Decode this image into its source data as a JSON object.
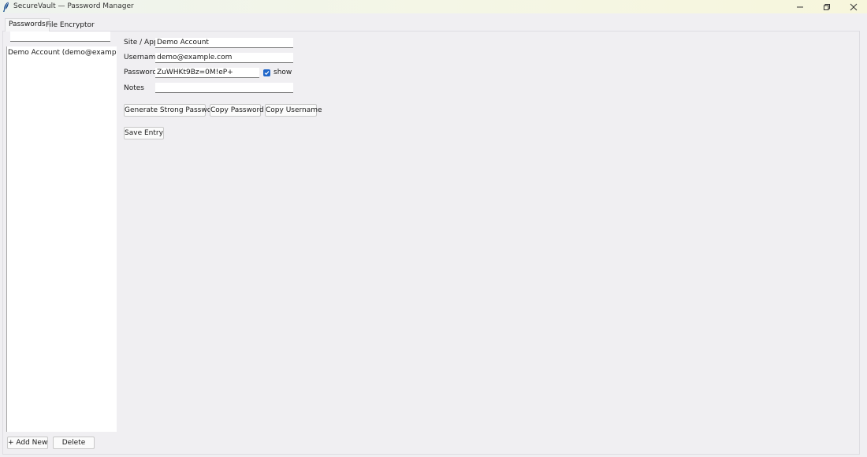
{
  "window": {
    "title": "SecureVault — Password Manager"
  },
  "tabs": [
    {
      "label": "Passwords",
      "active": true
    },
    {
      "label": "File Encryptor",
      "active": false
    }
  ],
  "sidebar": {
    "search": {
      "value": "",
      "placeholder": ""
    },
    "entries": [
      {
        "label": "Demo Account  (demo@example.co"
      }
    ],
    "add_label": "+ Add New",
    "delete_label": "Delete"
  },
  "form": {
    "site": {
      "label": "Site / App",
      "value": "Demo Account"
    },
    "username": {
      "label": "Username",
      "value": "demo@example.com"
    },
    "password": {
      "label": "Password",
      "value": "ZuWHKt9Bz=0M!eP+"
    },
    "show": {
      "label": "show",
      "checked": true
    },
    "notes": {
      "label": "Notes",
      "value": ""
    }
  },
  "actions": {
    "generate_label": "Generate Strong Password",
    "copy_password_label": "Copy Password",
    "copy_username_label": "Copy Username",
    "save_label": "Save Entry"
  },
  "colors": {
    "accent": "#1f66c9",
    "background": "#f0eff2"
  }
}
